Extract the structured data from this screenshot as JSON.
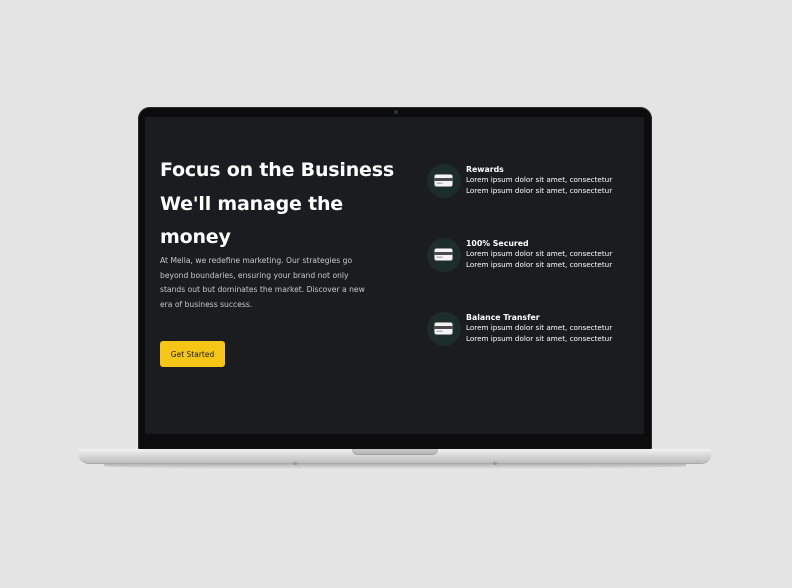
{
  "hero": {
    "headline_line1": "Focus on the Business",
    "headline_line2": "We'll manage the",
    "headline_line3": "money",
    "description": "At Mella, we redefine marketing. Our strategies go beyond boundaries, ensuring your brand not only stands out but dominates the market. Discover a new era of business success.",
    "cta_label": "Get Started"
  },
  "features": [
    {
      "title": "Rewards",
      "text": "Lorem ipsum dolor sit amet, consectetur Lorem ipsum dolor sit amet, consectetur",
      "icon": "credit-card-icon"
    },
    {
      "title": "100% Secured",
      "text": "Lorem ipsum dolor sit amet, consectetur Lorem ipsum dolor sit amet, consectetur",
      "icon": "credit-card-icon"
    },
    {
      "title": "Balance Transfer",
      "text": "Lorem ipsum dolor sit amet, consectetur Lorem ipsum dolor sit amet, consectetur",
      "icon": "credit-card-icon"
    }
  ],
  "colors": {
    "background": "#e4e4e4",
    "screen": "#1b1c1f",
    "accent": "#f5c518",
    "icon_circle": "#1d2d2b"
  }
}
